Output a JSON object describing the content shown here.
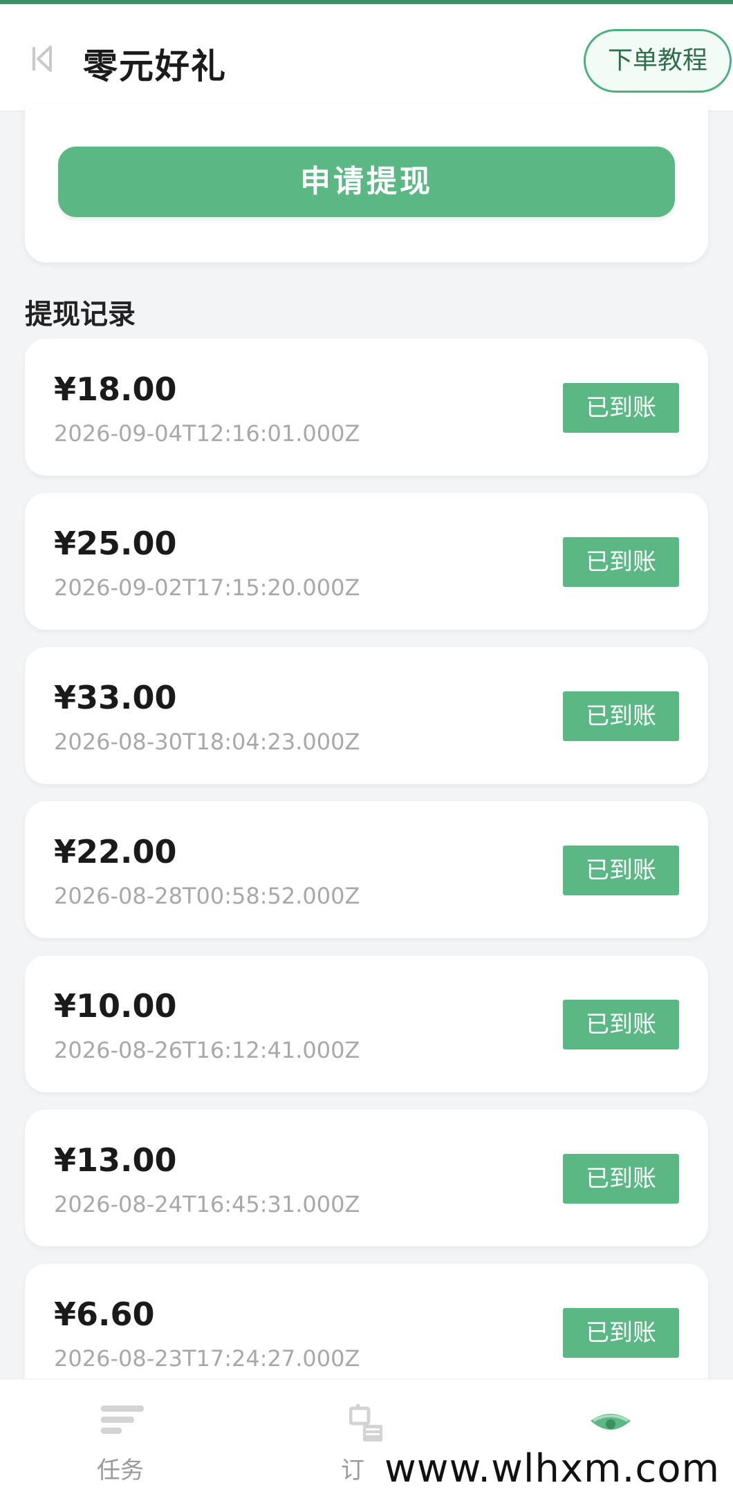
{
  "header": {
    "back_icon": "back-to-start-icon",
    "title": "零元好礼",
    "tutorial_label": "下单教程"
  },
  "apply": {
    "label": "申请提现"
  },
  "section": {
    "title": "提现记录"
  },
  "records": [
    {
      "amount": "¥18.00",
      "time": "2026-09-04T12:16:01.000Z",
      "status": "已到账"
    },
    {
      "amount": "¥25.00",
      "time": "2026-09-02T17:15:20.000Z",
      "status": "已到账"
    },
    {
      "amount": "¥33.00",
      "time": "2026-08-30T18:04:23.000Z",
      "status": "已到账"
    },
    {
      "amount": "¥22.00",
      "time": "2026-08-28T00:58:52.000Z",
      "status": "已到账"
    },
    {
      "amount": "¥10.00",
      "time": "2026-08-26T16:12:41.000Z",
      "status": "已到账"
    },
    {
      "amount": "¥13.00",
      "time": "2026-08-24T16:45:31.000Z",
      "status": "已到账"
    },
    {
      "amount": "¥6.60",
      "time": "2026-08-23T17:24:27.000Z",
      "status": "已到账"
    }
  ],
  "tabbar": {
    "tabs": [
      {
        "label": "任务",
        "icon": "task-list-icon"
      },
      {
        "label": "订",
        "icon": "order-icon"
      },
      {
        "label": "",
        "icon": "eye-icon",
        "active": true
      }
    ]
  },
  "watermark": "www.wlhxm.com",
  "colors": {
    "accent": "#5bb885",
    "dark_accent": "#3c8f63"
  }
}
